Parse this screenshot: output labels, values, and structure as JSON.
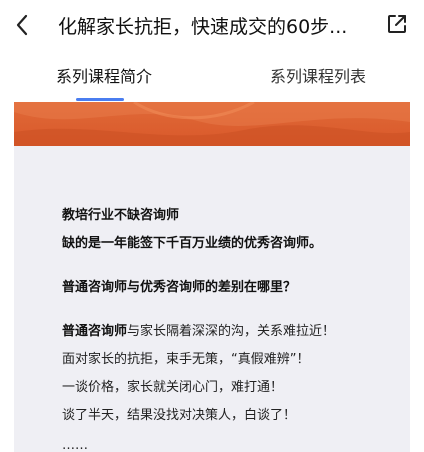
{
  "header": {
    "back_icon": "chevron-left-icon",
    "title": "化解家长抗拒，快速成交的60步...",
    "share_icon": "share-external-icon"
  },
  "tabs": [
    {
      "label": "系列课程简介",
      "active": true
    },
    {
      "label": "系列课程列表",
      "active": false
    }
  ],
  "colors": {
    "accent": "#4a7df0",
    "banner": "#d9582a",
    "content_bg": "#efeff4"
  },
  "article": {
    "p1_line1": "教培行业不缺咨询师",
    "p1_line2": "缺的是一年能签下千百万业绩的优秀咨询师。",
    "p2_line1": "普通咨询师与优秀咨询师的差别在哪里？",
    "p3_bold": "普通咨询师",
    "p3_rest": "与家长隔着深深的沟，关系难拉近！",
    "p3_line2": "面对家长的抗拒，束手无策，“真假难辨”！",
    "p3_line3": "一谈价格，家长就关闭心门，难打通！",
    "p3_line4": "谈了半天，结果没找对决策人，白谈了！",
    "p3_line5": "……"
  }
}
